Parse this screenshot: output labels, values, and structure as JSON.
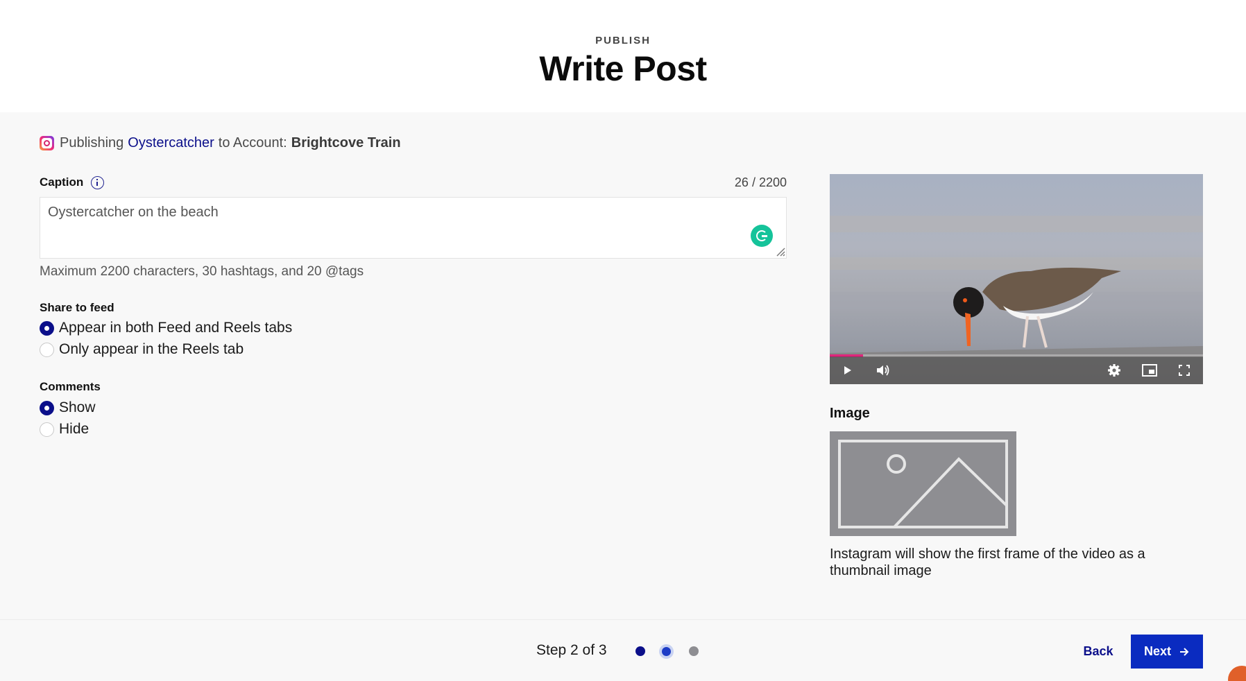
{
  "header": {
    "eyebrow": "PUBLISH",
    "title": "Write Post"
  },
  "publishing": {
    "prefix": "Publishing",
    "video_name": "Oystercatcher",
    "middle": "to Account:",
    "account": "Brightcove Train",
    "icon": "instagram-icon"
  },
  "caption": {
    "label": "Caption",
    "info_icon": "info-icon",
    "count": "26 / 2200",
    "value": "Oystercatcher on the beach",
    "helper": "Maximum 2200 characters, 30 hashtags, and 20 @tags"
  },
  "share_to_feed": {
    "label": "Share to feed",
    "options": [
      {
        "label": "Appear in both Feed and Reels tabs",
        "selected": true
      },
      {
        "label": "Only appear in the Reels tab",
        "selected": false
      }
    ]
  },
  "comments": {
    "label": "Comments",
    "options": [
      {
        "label": "Show",
        "selected": true
      },
      {
        "label": "Hide",
        "selected": false
      }
    ]
  },
  "video": {
    "progress_fraction": 0.09,
    "controls": [
      "play-icon",
      "volume-icon",
      "settings-icon",
      "picture-in-picture-icon",
      "fullscreen-icon"
    ]
  },
  "image": {
    "label": "Image",
    "placeholder_icon": "image-placeholder-icon",
    "note": "Instagram will show the first frame of the video as a thumbnail image"
  },
  "footer": {
    "step": "Step 2 of 3",
    "steps_total": 3,
    "current_step": 2,
    "back": "Back",
    "next": "Next"
  },
  "colors": {
    "accent": "#0b0f8a",
    "primary_button": "#0a2bc0",
    "progress": "#e0257c",
    "grammarly": "#15c39a"
  }
}
